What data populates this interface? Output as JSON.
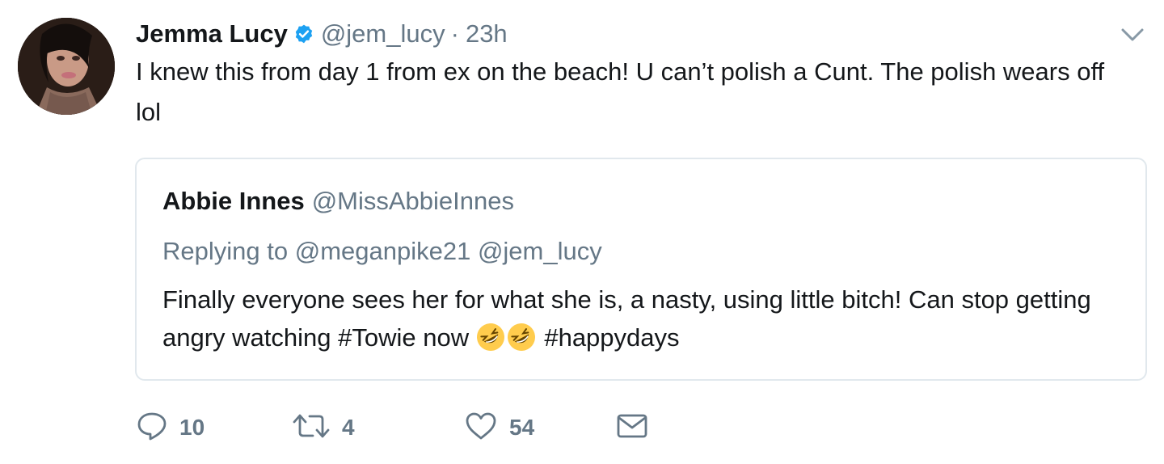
{
  "author": {
    "name": "Jemma Lucy",
    "handle": "@jem_lucy",
    "separator": "·",
    "time": "23h",
    "verified": true
  },
  "tweet_text": "I knew this from day 1 from ex on the beach! U can’t polish a Cunt. The polish wears off lol",
  "quoted_tweet": {
    "name": "Abbie Innes",
    "handle": "@MissAbbieInnes",
    "replying_prefix": "Replying to",
    "replying_to": [
      "@meganpike21",
      "@jem_lucy"
    ],
    "text_before_emoji": "Finally everyone sees her for what she is, a nasty, using little bitch! Can stop getting angry watching #Towie now ",
    "emojis": [
      "rolling-on-floor-laughing",
      "rolling-on-floor-laughing"
    ],
    "text_after_emoji": " #happydays"
  },
  "actions": {
    "reply_count": "10",
    "retweet_count": "4",
    "like_count": "54"
  },
  "icons": {
    "verified": "verified-badge-icon",
    "caret": "chevron-down-icon",
    "reply": "reply-bubble-icon",
    "retweet": "retweet-icon",
    "like": "heart-icon",
    "dm": "envelope-icon"
  },
  "colors": {
    "text": "#14171a",
    "secondary": "#657786",
    "verified": "#1da1f2",
    "border": "#e1e8ed",
    "emoji": "#ffcc4d"
  }
}
